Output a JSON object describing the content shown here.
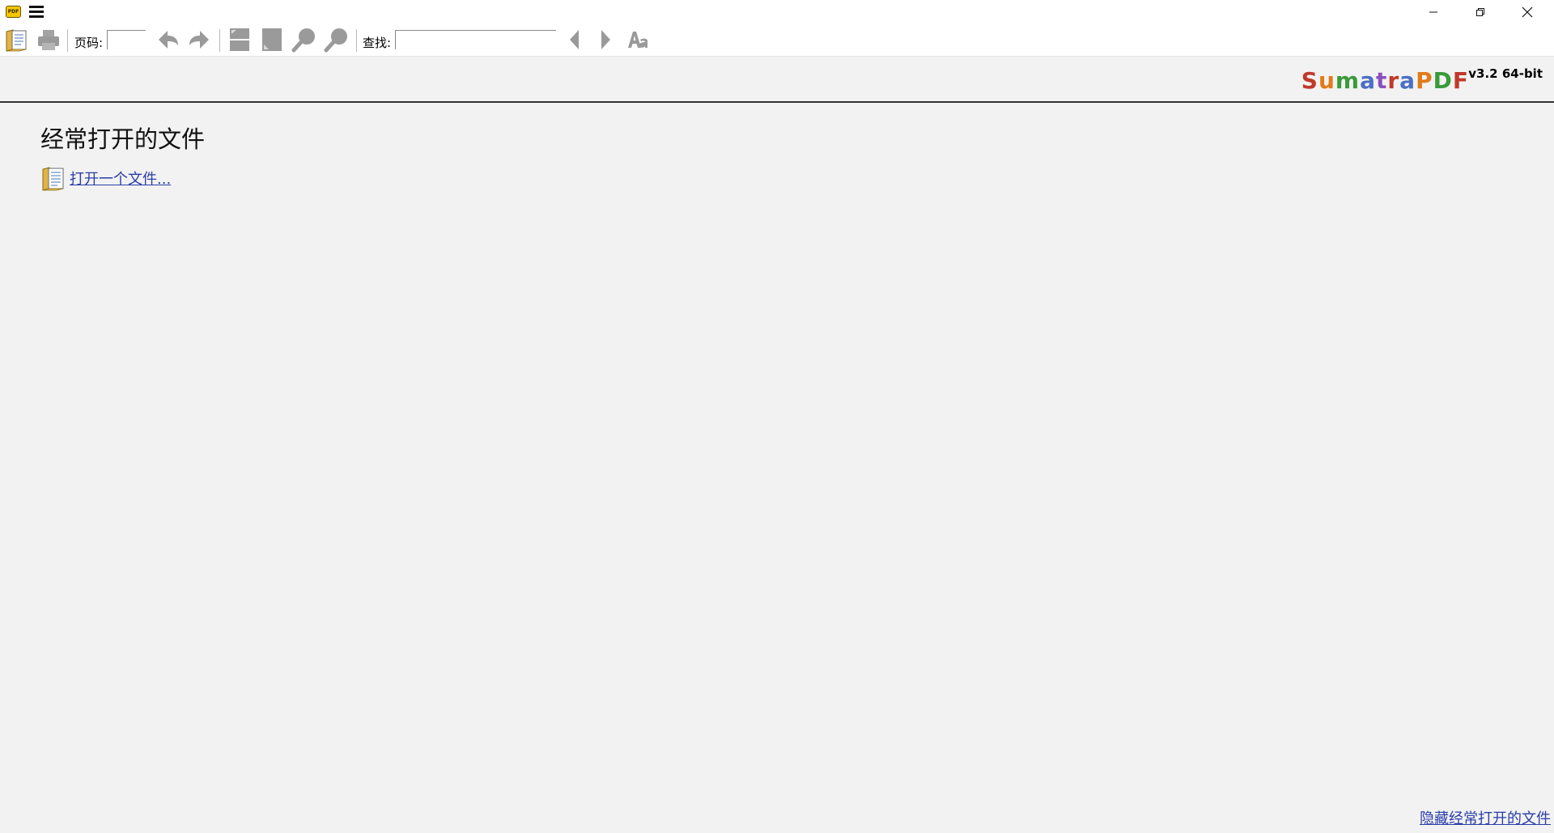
{
  "titlebar": {
    "app_icon_text": "PDF",
    "app_icon": "sumatrapdf-app-icon",
    "menu_icon": "hamburger-menu-icon",
    "minimize_icon": "minimize-icon",
    "restore_icon": "restore-icon",
    "close_icon": "close-icon"
  },
  "toolbar": {
    "page_label": "页码:",
    "page_value": "",
    "find_label": "查找:",
    "find_value": "",
    "icons": [
      "open-folder-icon",
      "print-icon",
      "back-icon",
      "forward-icon",
      "fit-page-icon",
      "fit-width-icon",
      "zoom-out-icon",
      "zoom-in-icon",
      "find-prev-icon",
      "find-next-icon",
      "match-case-icon"
    ]
  },
  "header": {
    "logo_letters": [
      "S",
      "u",
      "m",
      "a",
      "t",
      "r",
      "a",
      "P",
      "D",
      "F"
    ],
    "logo_colors": [
      "#c0392b",
      "#e07b1a",
      "#3a9a3a",
      "#4a6fc1",
      "#8a4fbe",
      "#c0392b",
      "#4a6fc1",
      "#e07b1a",
      "#3a9a3a",
      "#c0392b"
    ],
    "version": "v3.2 64-bit"
  },
  "main": {
    "title": "经常打开的文件",
    "open_file_link": "打开一个文件...",
    "hide_frequent_link": "隐藏经常打开的文件"
  },
  "colors": {
    "background": "#f2f2f2",
    "link": "#2a3ea8",
    "toolbar_icon_disabled": "#9a9a9a"
  }
}
